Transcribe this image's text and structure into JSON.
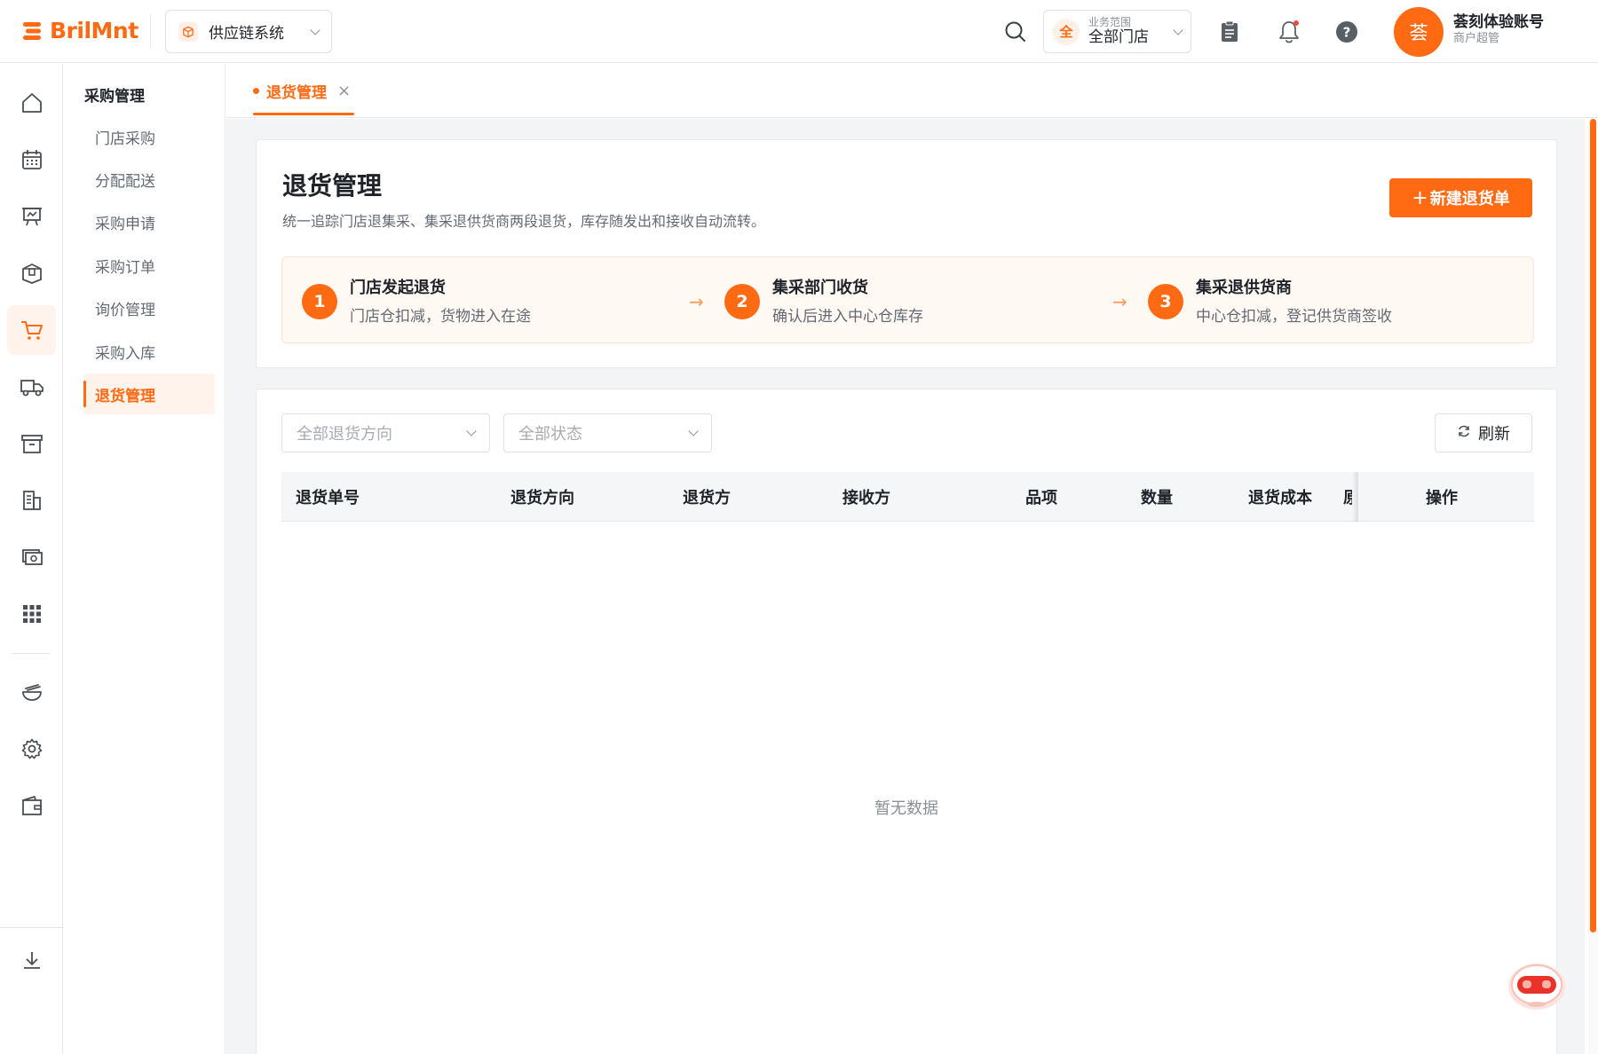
{
  "brand": {
    "name": "BrilMnt",
    "color": "#ff6a13"
  },
  "header": {
    "system_label": "供应链系统",
    "scope_small": "业务范围",
    "scope_main": "全部门店",
    "scope_badge": "全",
    "user_avatar": "荟",
    "user_name": "荟刻体验账号",
    "user_role": "商户超管"
  },
  "rail": {
    "icons": [
      "home-icon",
      "calendar-icon",
      "presentation-icon",
      "box-icon",
      "cart-icon",
      "truck-icon",
      "archive-icon",
      "building-icon",
      "cash-icon",
      "apps-grid-icon",
      "bowl-icon",
      "settings-icon",
      "wallet-icon",
      "download-icon"
    ],
    "active": "cart-icon"
  },
  "submenu": {
    "title": "采购管理",
    "items": [
      "门店采购",
      "分配配送",
      "采购申请",
      "采购订单",
      "询价管理",
      "采购入库",
      "退货管理"
    ],
    "active_index": 6
  },
  "tabs": [
    {
      "label": "退货管理",
      "close": "×"
    }
  ],
  "page": {
    "title": "退货管理",
    "description": "统一追踪门店退集采、集采退供货商两段退货，库存随发出和接收自动流转。",
    "create_button": "新建退货单",
    "create_button_icon": "+"
  },
  "steps": [
    {
      "num": "1",
      "title": "门店发起退货",
      "desc": "门店仓扣减，货物进入在途"
    },
    {
      "num": "2",
      "title": "集采部门收货",
      "desc": "确认后进入中心仓库存"
    },
    {
      "num": "3",
      "title": "集采退供货商",
      "desc": "中心仓扣减，登记供货商签收"
    }
  ],
  "filters": {
    "direction_placeholder": "全部退货方向",
    "status_placeholder": "全部状态",
    "refresh_label": "刷新"
  },
  "table": {
    "columns": [
      "退货单号",
      "退货方向",
      "退货方",
      "接收方",
      "品项",
      "数量",
      "退货成本",
      "原",
      "操作"
    ],
    "rows": [],
    "empty_text": "暂无数据"
  }
}
